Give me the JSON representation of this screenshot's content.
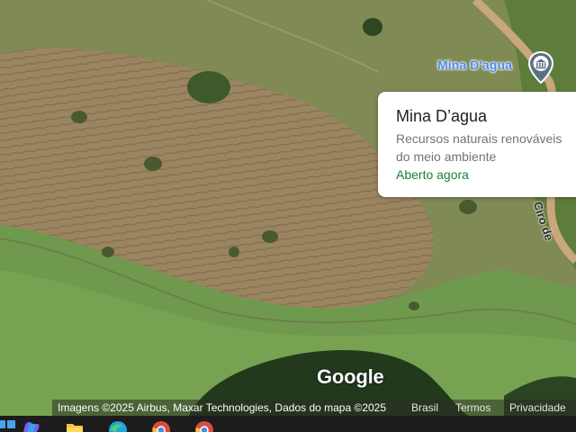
{
  "map": {
    "place_pin_label": "Mina D'agua",
    "place_pin_icon": "museum-icon",
    "road_label": "Ciro de",
    "google_logo": "Google"
  },
  "place_card": {
    "title": "Mina D’agua",
    "category_line1": "Recursos naturais renováveis",
    "category_line2": "do meio ambiente",
    "status": "Aberto agora",
    "status_color": "#188038"
  },
  "attribution": {
    "credits": "Imagens ©2025 Airbus, Maxar Technologies, Dados do mapa ©2025",
    "region": "Brasil",
    "terms": "Termos",
    "privacy": "Privacidade"
  },
  "taskbar": {
    "icons": [
      "windows-start-icon",
      "copilot-icon",
      "file-explorer-icon",
      "edge-icon",
      "chrome-icon",
      "chrome-icon"
    ]
  },
  "colors": {
    "pin_label": "#4b89f2",
    "card_bg": "#ffffff",
    "taskbar_bg": "#1c1c1c"
  }
}
